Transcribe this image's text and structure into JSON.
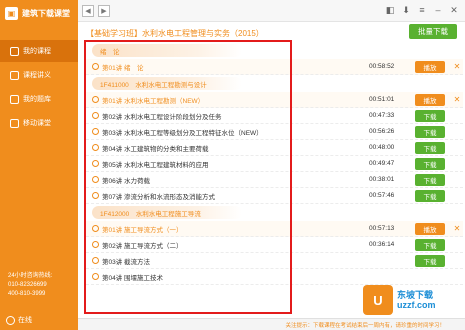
{
  "app": {
    "title": "建筑下载课堂"
  },
  "sidebar": {
    "items": [
      {
        "label": "我的课程",
        "icon": "book-icon",
        "active": true
      },
      {
        "label": "课程讲义",
        "icon": "notes-icon",
        "active": false
      },
      {
        "label": "我的题库",
        "icon": "question-bank-icon",
        "active": false
      },
      {
        "label": "移动课堂",
        "icon": "mobile-icon",
        "active": false
      }
    ],
    "hotline_title": "24小时咨询热线:",
    "phone1": "010-82326699",
    "phone2": "400-810-3999",
    "online": "在线"
  },
  "course": {
    "title": "【基础学习班】水利水电工程管理与实务（2015）",
    "batch_download": "批量下载"
  },
  "sections": [
    {
      "label": "绪　论",
      "rows": [
        {
          "lecture": "第01讲",
          "title": "绪　论",
          "duration": "00:58:52",
          "action": "播放",
          "deletable": true,
          "highlight": true
        }
      ]
    },
    {
      "label": "1F411000　水利水电工程勘测与设计",
      "rows": [
        {
          "lecture": "第01讲",
          "title": "水利水电工程勘测（NEW）",
          "duration": "00:51:01",
          "action": "播放",
          "deletable": true,
          "highlight": true
        },
        {
          "lecture": "第02讲",
          "title": "水利水电工程设计阶段划分及任务",
          "duration": "00:47:33",
          "action": "下载",
          "deletable": false,
          "highlight": false
        },
        {
          "lecture": "第03讲",
          "title": "水利水电工程等级划分及工程特征水位（NEW）",
          "duration": "00:56:26",
          "action": "下载",
          "deletable": false,
          "highlight": false
        },
        {
          "lecture": "第04讲",
          "title": "水工建筑物的分类和主要荷载",
          "duration": "00:48:00",
          "action": "下载",
          "deletable": false,
          "highlight": false
        },
        {
          "lecture": "第05讲",
          "title": "水利水电工程建筑材料的应用",
          "duration": "00:49:47",
          "action": "下载",
          "deletable": false,
          "highlight": false
        },
        {
          "lecture": "第06讲",
          "title": "水力荷载",
          "duration": "00:38:01",
          "action": "下载",
          "deletable": false,
          "highlight": false
        },
        {
          "lecture": "第07讲",
          "title": "渗流分析和水流形态及消能方式",
          "duration": "00:57:46",
          "action": "下载",
          "deletable": false,
          "highlight": false
        }
      ]
    },
    {
      "label": "1F412000　水利水电工程施工导流",
      "rows": [
        {
          "lecture": "第01讲",
          "title": "施工导流方式（一）",
          "duration": "00:57:13",
          "action": "播放",
          "deletable": true,
          "highlight": true
        },
        {
          "lecture": "第02讲",
          "title": "施工导流方式（二）",
          "duration": "00:36:14",
          "action": "下载",
          "deletable": false,
          "highlight": false
        },
        {
          "lecture": "第03讲",
          "title": "截流方法",
          "duration": "",
          "action": "下载",
          "deletable": false,
          "highlight": false
        },
        {
          "lecture": "第04讲",
          "title": "围堰施工技术",
          "duration": "",
          "action": "",
          "deletable": false,
          "highlight": false
        }
      ]
    }
  ],
  "status": {
    "text": "关注提示：下载课程在考试结束后一周内有，请珍重的时间学习！"
  },
  "watermark": {
    "text1": "东坡下载",
    "text2": "uzzf.com"
  }
}
